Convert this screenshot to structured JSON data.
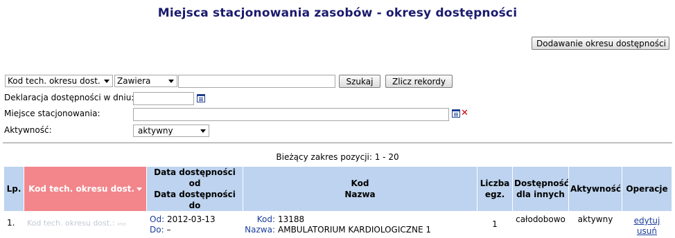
{
  "page": {
    "title": "Miejsca stacjonowania zasobów - okresy dostępności"
  },
  "toolbar": {
    "add_label": "Dodawanie okresu dostępności"
  },
  "search": {
    "field_value": "Kod tech. okresu dost.",
    "operator_value": "Zawiera",
    "query_value": "",
    "search_label": "Szukaj",
    "count_label": "Zlicz rekordy"
  },
  "filters": {
    "declaration_label": "Deklaracja dostępności w dniu:",
    "declaration_value": "",
    "location_label": "Miejsce stacjonowania:",
    "location_value": "",
    "active_label": "Aktywność:",
    "active_value": "aktywny"
  },
  "results": {
    "range_text": "Bieżący zakres pozycji: 1 - 20"
  },
  "table": {
    "headers": {
      "lp": "Lp.",
      "kod_tech": "Kod tech. okresu dost.",
      "date_from": "Data dostępności od",
      "date_to": "Data dostępności do",
      "kod": "Kod",
      "nazwa": "Nazwa",
      "count_line1": "Liczba",
      "count_line2": "egz.",
      "avail_line1": "Dostępność",
      "avail_line2": "dla innych",
      "active": "Aktywność",
      "ops": "Operacje"
    },
    "rows": [
      {
        "lp": "1.",
        "kod_tech": "Kod tech. okresu dost.:",
        "kod_tech_small": "4703",
        "od_label": "Od:",
        "od_value": "2012-03-13",
        "do_label": "Do:",
        "do_value": "–",
        "kod_label": "Kod:",
        "kod_value": "13188",
        "nazwa_label": "Nazwa:",
        "nazwa_value": "AMBULATORIUM KARDIOLOGICZNE 1",
        "count": "1",
        "availability": "całodobowo",
        "active": "aktywny",
        "edit": "edytuj",
        "delete": "usuń"
      }
    ]
  }
}
